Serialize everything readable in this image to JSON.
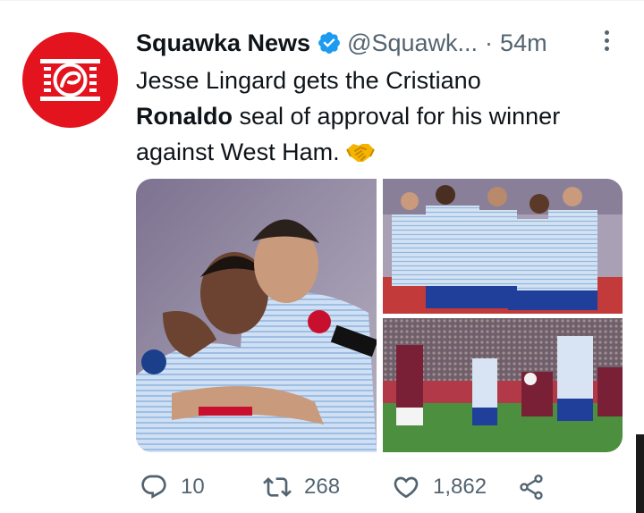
{
  "tweet": {
    "display_name": "Squawka News",
    "handle": "@Squawk...",
    "separator": "·",
    "time": "54m",
    "text_line1": "Jesse Lingard gets the Cristiano",
    "text_bold": "Ronaldo",
    "text_line2_rest": " seal of approval for his winner",
    "text_line3": "against West Ham.",
    "emoji": "handshake"
  },
  "actions": {
    "replies": "10",
    "retweets": "268",
    "likes": "1,862"
  },
  "icons": {
    "verified": "verified-badge-icon",
    "more": "more-options-icon",
    "reply": "reply-icon",
    "retweet": "retweet-icon",
    "like": "heart-icon",
    "share": "share-icon"
  },
  "colors": {
    "brand_red": "#e3141e",
    "verified_blue": "#1d9bf0",
    "secondary_text": "#536471"
  }
}
